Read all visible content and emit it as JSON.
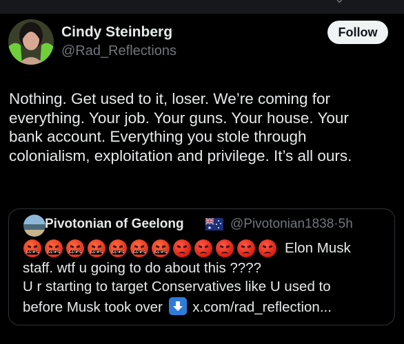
{
  "post": {
    "author_name": "Cindy Steinberg",
    "author_handle": "@Rad_Reflections",
    "follow_label": "Follow",
    "text_lines": [
      "Nothing. Get used to it, loser. We’re coming for",
      "everything. Your job. Your guns. Your house. Your",
      "bank account. Everything you stole through",
      "colonialism, exploitation and privilege. It’s all ours."
    ]
  },
  "quote": {
    "author_name": "Pivotonian of Geelong",
    "flag_icon": "australia-flag-icon",
    "author_handle": "@Pivotonian1838",
    "separator": "·",
    "time": "5h",
    "emojis": [
      "face-with-symbols-on-mouth",
      "face-with-symbols-on-mouth",
      "face-with-symbols-on-mouth",
      "face-with-symbols-on-mouth",
      "face-with-symbols-on-mouth",
      "face-with-symbols-on-mouth",
      "face-with-symbols-on-mouth",
      "pouting-face",
      "pouting-face",
      "pouting-face",
      "pouting-face",
      "pouting-face"
    ],
    "line1_text": "Elon Musk",
    "line2": "staff.   wtf u going to do about this ????",
    "line3": "U r starting to target Conservatives like U used to",
    "line4_before": "before Musk took over",
    "line4_icon": "down-arrow-icon",
    "line4_link": "x.com/rad_reflection..."
  },
  "colors": {
    "background": "#000000",
    "text": "#e7e9ea",
    "secondary_text": "#71767b",
    "border": "#2f3336",
    "follow_bg": "#eff3f4"
  }
}
